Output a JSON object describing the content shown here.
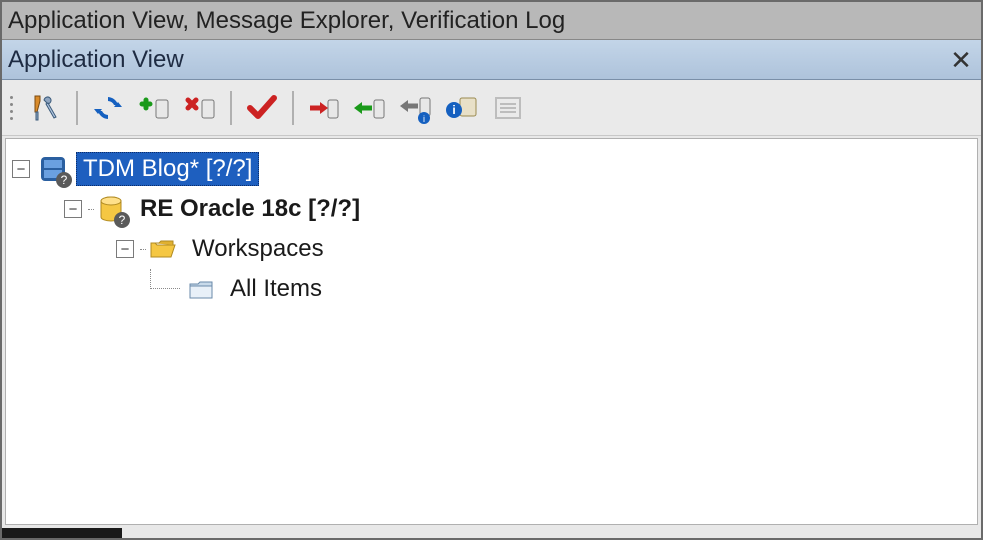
{
  "tabStrip": {
    "label": "Application View, Message Explorer, Verification Log"
  },
  "panel": {
    "title": "Application View"
  },
  "toolbar": {
    "config": "Configure",
    "refresh": "Refresh",
    "add": "Add",
    "remove": "Remove",
    "validate": "Validate",
    "export": "Export",
    "import": "Import",
    "importInfo": "Import with Info",
    "infoTable": "Info",
    "details": "Details"
  },
  "tree": {
    "root": {
      "label": "TDM Blog* [?/?]",
      "expanded": true,
      "selected": true
    },
    "database": {
      "label": "RE Oracle 18c [?/?]",
      "expanded": true
    },
    "workspaces": {
      "label": "Workspaces",
      "expanded": true
    },
    "allItems": {
      "label": "All Items"
    }
  }
}
